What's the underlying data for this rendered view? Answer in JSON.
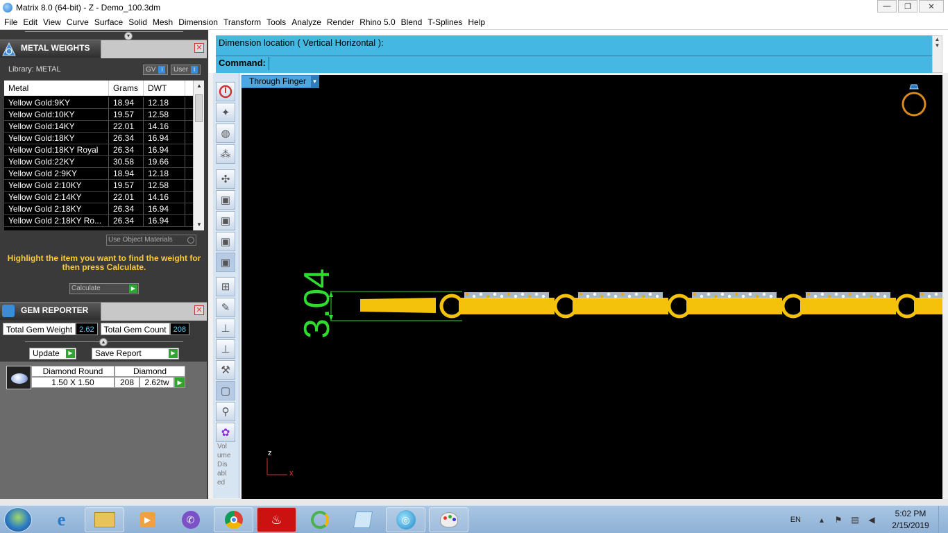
{
  "window": {
    "title": "Matrix 8.0 (64-bit) - Z - Demo_100.3dm",
    "minimize": "—",
    "maximize": "❐",
    "close": "✕"
  },
  "menubar": [
    "File",
    "Edit",
    "View",
    "Curve",
    "Surface",
    "Solid",
    "Mesh",
    "Dimension",
    "Transform",
    "Tools",
    "Analyze",
    "Render",
    "Rhino 5.0",
    "Blend",
    "T-Splines",
    "Help"
  ],
  "metal_weights": {
    "title": "METAL WEIGHTS",
    "library_label": "Library: METAL",
    "toggle_gv": "GV",
    "toggle_user": "User",
    "columns": [
      "Metal",
      "Grams",
      "DWT"
    ],
    "rows": [
      [
        "Yellow Gold:9KY",
        "18.94",
        "12.18"
      ],
      [
        "Yellow Gold:10KY",
        "19.57",
        "12.58"
      ],
      [
        "Yellow Gold:14KY",
        "22.01",
        "14.16"
      ],
      [
        "Yellow Gold:18KY",
        "26.34",
        "16.94"
      ],
      [
        "Yellow Gold:18KY Royal",
        "26.34",
        "16.94"
      ],
      [
        "Yellow Gold:22KY",
        "30.58",
        "19.66"
      ],
      [
        "Yellow Gold 2:9KY",
        "18.94",
        "12.18"
      ],
      [
        "Yellow Gold 2:10KY",
        "19.57",
        "12.58"
      ],
      [
        "Yellow Gold 2:14KY",
        "22.01",
        "14.16"
      ],
      [
        "Yellow Gold 2:18KY",
        "26.34",
        "16.94"
      ],
      [
        "Yellow Gold 2:18KY Ro...",
        "26.34",
        "16.94"
      ]
    ],
    "use_object_materials": "Use Object Materials",
    "hint": "Highlight the item you want to find the weight for then press Calculate.",
    "calculate": "Calculate"
  },
  "gem_reporter": {
    "title": "GEM REPORTER",
    "total_weight_label": "Total Gem Weight",
    "total_weight_value": "2.62",
    "total_count_label": "Total Gem Count",
    "total_count_value": "208",
    "update": "Update",
    "save_report": "Save Report",
    "gem": {
      "cut": "Diamond Round",
      "material": "Diamond",
      "size": "1.50 X 1.50",
      "count": "208",
      "weight": "2.62tw"
    }
  },
  "command": {
    "prompt": "Dimension location ( Vertical  Horizontal ):",
    "label": "Command:",
    "value": ""
  },
  "toolbar": {
    "icons": [
      "power-icon",
      "pinwheel-icon",
      "globe-icon",
      "nodes-icon",
      "axes-move-icon",
      "box-view-1-icon",
      "box-view-2-icon",
      "box-view-3-icon",
      "box-view-4-icon",
      "scale-icon",
      "pen-tool-icon",
      "off-tool-icon",
      "r-tool-icon",
      "hammer-icon",
      "h-button-icon",
      "walk-icon",
      "gears-icon"
    ],
    "volume_text": "Volume Disabled"
  },
  "viewport": {
    "view_name": "Through Finger",
    "dimension_text": "3.04",
    "axis_z": "z",
    "axis_x": "x",
    "colors": {
      "background": "#000000",
      "gold": "#f5c20b",
      "dimension": "#2ddc2d"
    }
  },
  "taskbar": {
    "apps": [
      "internet-explorer-icon",
      "file-explorer-icon",
      "media-player-icon",
      "viber-icon",
      "chrome-icon",
      "garena-icon",
      "coccoc-icon",
      "notepad-icon",
      "matrix-icon",
      "paint-icon"
    ],
    "language": "EN",
    "time": "5:02 PM",
    "date": "2/15/2019"
  }
}
